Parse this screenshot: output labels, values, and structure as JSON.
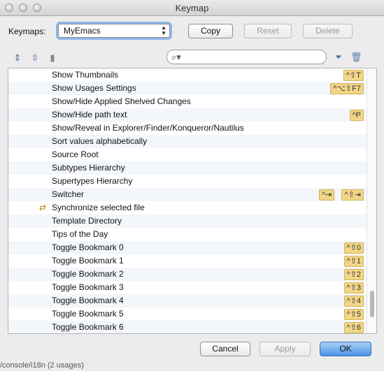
{
  "window": {
    "title": "Keymap"
  },
  "keymaps": {
    "label": "Keymaps:",
    "selected": "MyEmacs"
  },
  "buttons": {
    "copy": "Copy",
    "reset": "Reset",
    "delete": "Delete",
    "cancel": "Cancel",
    "apply": "Apply",
    "ok": "OK"
  },
  "search": {
    "value": ""
  },
  "rows": [
    {
      "label": "Show Thumbnails",
      "keys": [
        "^⇧T"
      ]
    },
    {
      "label": "Show Usages Settings",
      "keys": [
        "^⌥⇧F7"
      ]
    },
    {
      "label": "Show/Hide Applied Shelved Changes",
      "keys": []
    },
    {
      "label": "Show/Hide path text",
      "keys": [
        "^P"
      ]
    },
    {
      "label": "Show/Reveal in Explorer/Finder/Konqueror/Nautilus",
      "keys": []
    },
    {
      "label": "Sort values alphabetically",
      "keys": []
    },
    {
      "label": "Source Root",
      "keys": []
    },
    {
      "label": "Subtypes Hierarchy",
      "keys": []
    },
    {
      "label": "Supertypes Hierarchy",
      "keys": []
    },
    {
      "label": "Switcher",
      "keys": [
        "^⇥",
        "^⇧⇥"
      ]
    },
    {
      "label": "Synchronize selected file",
      "keys": [],
      "icon": "sync-icon"
    },
    {
      "label": "Template Directory",
      "keys": []
    },
    {
      "label": "Tips of the Day",
      "keys": []
    },
    {
      "label": "Toggle Bookmark 0",
      "keys": [
        "^⇧0"
      ]
    },
    {
      "label": "Toggle Bookmark 1",
      "keys": [
        "^⇧1"
      ]
    },
    {
      "label": "Toggle Bookmark 2",
      "keys": [
        "^⇧2"
      ]
    },
    {
      "label": "Toggle Bookmark 3",
      "keys": [
        "^⇧3"
      ]
    },
    {
      "label": "Toggle Bookmark 4",
      "keys": [
        "^⇧4"
      ]
    },
    {
      "label": "Toggle Bookmark 5",
      "keys": [
        "^⇧5"
      ]
    },
    {
      "label": "Toggle Bookmark 6",
      "keys": [
        "^⇧6"
      ]
    }
  ],
  "footer_text": "/console/i18n (2 usages)"
}
